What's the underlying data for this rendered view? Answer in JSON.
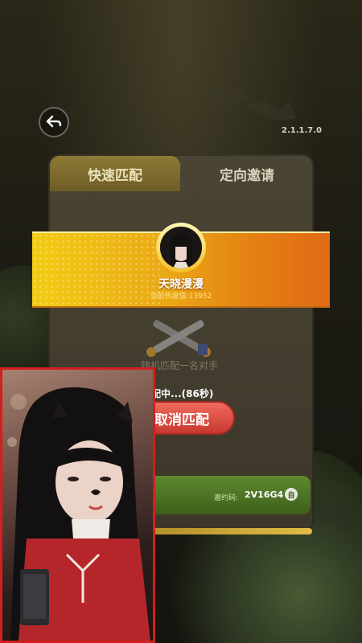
{
  "header": {
    "back_icon": "back-arrow-icon",
    "version": "2.1.1.7.0"
  },
  "tabs": [
    {
      "label": "快速匹配",
      "active": true
    },
    {
      "label": "定向邀请",
      "active": false
    }
  ],
  "player": {
    "name": "天晓漫漫",
    "heat_label": "当前热度值:13952"
  },
  "match": {
    "icon": "crossed-swords-icon",
    "status_text": "随机匹配一名对手",
    "countdown_text": "配中...(86秒)",
    "cancel_label": "取消匹配"
  },
  "invite": {
    "code_label": "邀约码:",
    "code_value": "2V16G4",
    "copy_label": "自",
    "copy_icon": "copy-icon"
  },
  "colors": {
    "banner_start": "#f3cc13",
    "banner_end": "#e06a16",
    "cancel_button": "#e0483d",
    "camera_border": "#d41f1f",
    "code_bar": "#4e7425"
  }
}
